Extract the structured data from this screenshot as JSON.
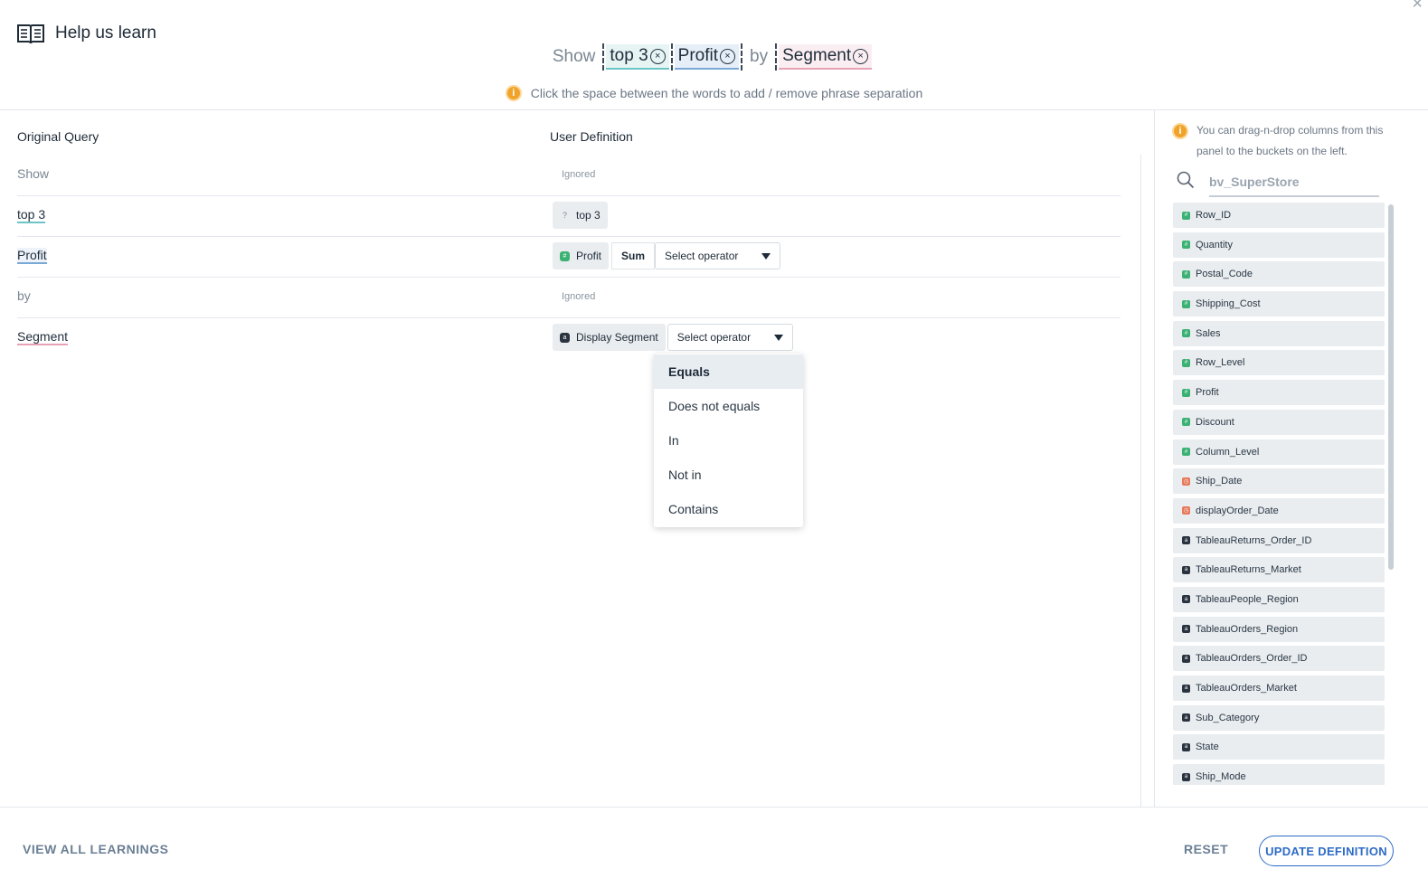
{
  "header": {
    "title": "Help us learn",
    "close_symbol": "×",
    "query": {
      "show": "Show",
      "chip1": "top 3",
      "chip2": "Profit",
      "by": "by",
      "chip3": "Segment",
      "remove_symbol": "×"
    },
    "hint": "Click the space between the words to add / remove phrase separation",
    "hint_icon_symbol": "i"
  },
  "table": {
    "col_original": "Original Query",
    "col_definition": "User Definition",
    "rows": [
      {
        "original": "Show",
        "definition": "Ignored"
      },
      {
        "original": "top 3",
        "definition": "top 3",
        "icon_symbol": "?"
      },
      {
        "original": "Profit",
        "definition": "Profit",
        "aggregate": "Sum",
        "operator": "Select operator",
        "icon_symbol": "#"
      },
      {
        "original": "by",
        "definition": "Ignored"
      },
      {
        "original": "Segment",
        "definition": "Display Segment",
        "operator": "Select operator",
        "icon_symbol": "a"
      }
    ]
  },
  "dropdown": {
    "options": [
      "Equals",
      "Does not equals",
      "In",
      "Not in",
      "Contains"
    ],
    "selected": "Equals"
  },
  "right_panel": {
    "hint": "You can drag-n-drop columns from this panel to the buckets on the left.",
    "search_placeholder": "bv_SuperStore",
    "columns": [
      {
        "name": "Row_ID",
        "type": "number",
        "icon_symbol": "#"
      },
      {
        "name": "Quantity",
        "type": "number",
        "icon_symbol": "#"
      },
      {
        "name": "Postal_Code",
        "type": "number",
        "icon_symbol": "#"
      },
      {
        "name": "Shipping_Cost",
        "type": "number",
        "icon_symbol": "#"
      },
      {
        "name": "Sales",
        "type": "number",
        "icon_symbol": "#"
      },
      {
        "name": "Row_Level",
        "type": "number",
        "icon_symbol": "#"
      },
      {
        "name": "Profit",
        "type": "number",
        "icon_symbol": "#"
      },
      {
        "name": "Discount",
        "type": "number",
        "icon_symbol": "#"
      },
      {
        "name": "Column_Level",
        "type": "number",
        "icon_symbol": "#"
      },
      {
        "name": "Ship_Date",
        "type": "date",
        "icon_symbol": "◷"
      },
      {
        "name": "displayOrder_Date",
        "type": "date",
        "icon_symbol": "◷"
      },
      {
        "name": "TableauReturns_Order_ID",
        "type": "text",
        "icon_symbol": "a"
      },
      {
        "name": "TableauReturns_Market",
        "type": "text",
        "icon_symbol": "a"
      },
      {
        "name": "TableauPeople_Region",
        "type": "text",
        "icon_symbol": "a"
      },
      {
        "name": "TableauOrders_Region",
        "type": "text",
        "icon_symbol": "a"
      },
      {
        "name": "TableauOrders_Order_ID",
        "type": "text",
        "icon_symbol": "a"
      },
      {
        "name": "TableauOrders_Market",
        "type": "text",
        "icon_symbol": "a"
      },
      {
        "name": "Sub_Category",
        "type": "text",
        "icon_symbol": "a"
      },
      {
        "name": "State",
        "type": "text",
        "icon_symbol": "a"
      },
      {
        "name": "Ship_Mode",
        "type": "text",
        "icon_symbol": "a"
      }
    ]
  },
  "footer": {
    "view_all": "VIEW ALL LEARNINGS",
    "reset": "RESET",
    "update": "UPDATE DEFINITION"
  },
  "colors": {
    "accent": "#2e6bc6",
    "number_type": "#3bb273",
    "date_type": "#e67a5a",
    "text_type": "#2a3440",
    "info": "#f0a32b"
  }
}
